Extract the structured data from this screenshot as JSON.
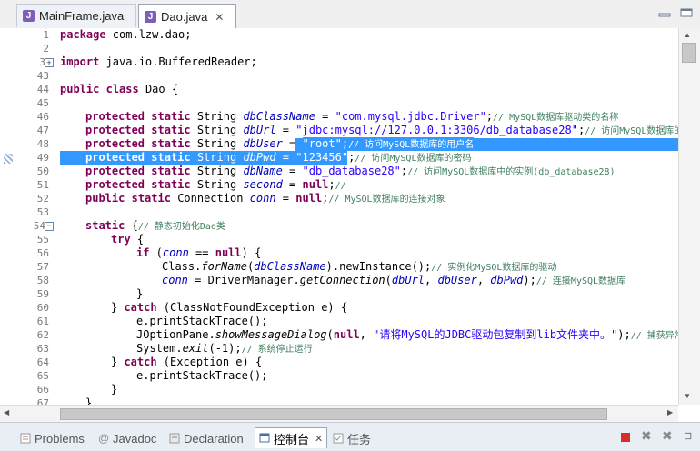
{
  "tabs": [
    {
      "label": "MainFrame.java"
    },
    {
      "label": "Dao.java",
      "close": "✕"
    }
  ],
  "line_numbers": [
    "1",
    "2",
    "3",
    "43",
    "44",
    "45",
    "46",
    "47",
    "48",
    "49",
    "50",
    "51",
    "52",
    "53",
    "54",
    "55",
    "56",
    "57",
    "58",
    "59",
    "60",
    "61",
    "62",
    "63",
    "64",
    "65",
    "66",
    "67"
  ],
  "code": {
    "l1_kw": "package",
    "l1_rest": " com.lzw.dao;",
    "l3_kw": "import",
    "l3_rest": " java.io.BufferedReader;",
    "l43_kw1": "public",
    "l43_kw2": "class",
    "l43_rest": " Dao {",
    "kw_protected": "protected",
    "kw_static": "static",
    "kw_public": "public",
    "type_string": "String",
    "type_connection": "Connection",
    "f_dbClassName": "dbClassName",
    "s_driver": "\"com.mysql.jdbc.Driver\"",
    "c45": "// MySQL数据库驱动类的名称",
    "f_dbUrl": "dbUrl",
    "s_url": "\"jdbc:mysql://127.0.0.1:3306/db_database28\"",
    "c46": "// 访问MySQL数据库的路",
    "f_dbUser": "dbUser",
    "s_root": "\"root\"",
    "c47": "// 访问MySQL数据库的用户名",
    "f_dbPwd": "dbPwd",
    "s_pwd": "\"123456\"",
    "c48": "// 访问MySQL数据库的密码",
    "f_dbName": "dbName",
    "s_dbname": "\"db_database28\"",
    "c49": "// 访问MySQL数据库中的实例(db_database28)",
    "f_second": "second",
    "kw_null": "null",
    "c50": "//",
    "f_conn": "conn",
    "c51": "// MySQL数据库的连接对象",
    "l53_kw": "static",
    "l53_rest": " {",
    "c53": "// 静态初始化Dao类",
    "kw_try": "try",
    "kw_if": "if",
    "l56_rest": "Class.",
    "m_forName": "forName",
    "l56_tail": ").newInstance();",
    "c56": "// 实例化MySQL数据库的驱动",
    "l57_mid": " = DriverManager.",
    "m_getConnection": "getConnection",
    "c57": "// 连接MySQL数据库",
    "kw_catch": "catch",
    "l59_rest": " (ClassNotFoundException e) {",
    "l60": "e.printStackTrace();",
    "l61_a": "JOptionPane.",
    "m_show": "showMessageDialog",
    "s_msg": "\"请将MySQL的JDBC驱动包复制到lib文件夹中。\"",
    "c61": "// 捕获异常后, 弹出提示",
    "l62_a": "System.",
    "m_exit": "exit",
    "l62_b": "(-1);",
    "c62": "// 系统停止运行",
    "l63_rest": " (Exception e) {",
    "brace": "}"
  },
  "bottom_tabs": [
    {
      "label": "Problems"
    },
    {
      "label": "Javadoc"
    },
    {
      "label": "Declaration"
    },
    {
      "label": "控制台",
      "close": "✕"
    },
    {
      "label": "任务"
    }
  ],
  "colors": {
    "keyword": "#7f0055",
    "field": "#0000c0",
    "string": "#2a00ff",
    "comment": "#3f7f5f",
    "selection": "#3399ff"
  }
}
